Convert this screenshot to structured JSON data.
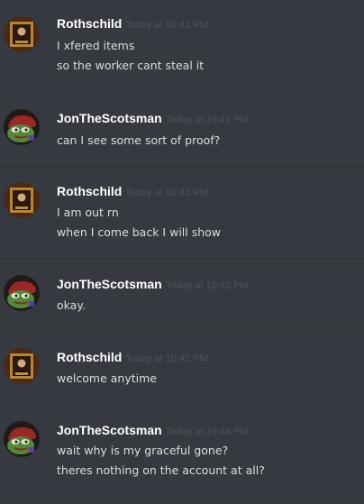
{
  "messages": [
    {
      "author": "Rothschild",
      "avatar_icon": "framed-portrait-icon",
      "timestamp": "Today at 10:41 PM",
      "lines": [
        "I xfered items",
        "so the worker cant steal it"
      ]
    },
    {
      "author": "JonTheScotsman",
      "avatar_icon": "pepe-frog-icon",
      "timestamp": "Today at 10:41 PM",
      "lines": [
        "can I see some sort of proof?"
      ]
    },
    {
      "author": "Rothschild",
      "avatar_icon": "framed-portrait-icon",
      "timestamp": "Today at 10:42 PM",
      "lines": [
        "I am out rn",
        "when I come back I will show"
      ]
    },
    {
      "author": "JonTheScotsman",
      "avatar_icon": "pepe-frog-icon",
      "timestamp": "Today at 10:42 PM",
      "lines": [
        "okay."
      ]
    },
    {
      "author": "Rothschild",
      "avatar_icon": "framed-portrait-icon",
      "timestamp": "Today at 10:42 PM",
      "lines": [
        "welcome anytime"
      ]
    },
    {
      "author": "JonTheScotsman",
      "avatar_icon": "pepe-frog-icon",
      "timestamp": "Today at 10:44 PM",
      "lines": [
        "wait why is my graceful gone?",
        "theres nothing on the account at all?"
      ]
    }
  ]
}
